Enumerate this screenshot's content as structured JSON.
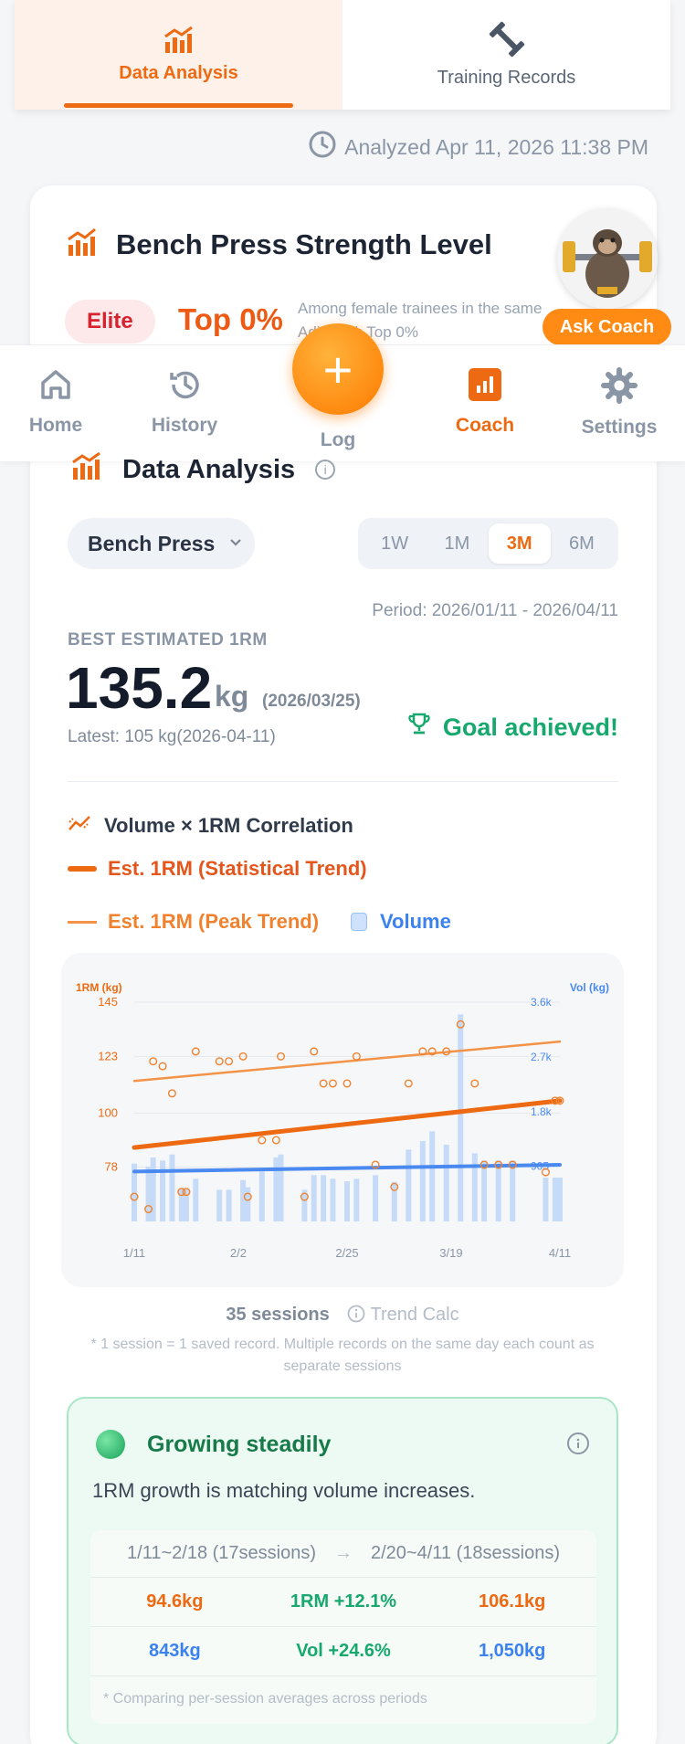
{
  "top_tabs": [
    {
      "label": "Data Analysis",
      "active": true,
      "icon": "bar-chart-up-icon"
    },
    {
      "label": "Training Records",
      "active": false,
      "icon": "dumbbell-icon"
    }
  ],
  "analyzed": "Analyzed Apr 11, 2026 11:38 PM",
  "strength": {
    "title": "Bench Press Strength Level",
    "badge": "Elite",
    "top": "Top 0%",
    "among_line1": "Among female trainees in the same",
    "among_line2": "Adjusted: Top 0%",
    "ask_coach": "Ask Coach"
  },
  "nav": {
    "items": [
      {
        "label": "Home",
        "icon": "home-icon"
      },
      {
        "label": "History",
        "icon": "history-icon"
      },
      {
        "label": "Coach",
        "icon": "coach-icon",
        "active": true
      },
      {
        "label": "Settings",
        "icon": "gear-icon"
      }
    ],
    "fab_label": "Log",
    "fab_symbol": "+"
  },
  "analysis": {
    "title": "Data Analysis",
    "info": "i",
    "exercise": "Bench Press",
    "ranges": [
      "1W",
      "1M",
      "3M",
      "6M"
    ],
    "active_range": "3M",
    "period": "Period: 2026/01/11 - 2026/04/11",
    "best_label": "BEST ESTIMATED 1RM",
    "best_value": "135.2",
    "best_unit": "kg",
    "best_date": "(2026/03/25)",
    "latest": "Latest: 105 kg(2026-04-11)",
    "goal": "Goal achieved!"
  },
  "correlation": {
    "title": "Volume × 1RM Correlation",
    "legend_stat": "Est. 1RM (Statistical Trend)",
    "legend_peak": "Est. 1RM (Peak Trend)",
    "legend_volume": "Volume"
  },
  "colors": {
    "accent": "#ee6a12",
    "peak": "#f39348",
    "volume_bar": "#c6dbf7",
    "volume_trend": "#4a8af0",
    "success": "#17a86d"
  },
  "chart_data": {
    "type": "line",
    "left_axis_label": "1RM (kg)",
    "right_axis_label": "Vol (kg)",
    "left_ticks": [
      78,
      100,
      123,
      145
    ],
    "right_ticks": [
      "905",
      "1.8k",
      "2.7k",
      "3.6k"
    ],
    "ylim_left": [
      56,
      145
    ],
    "ylim_right": [
      0,
      3600
    ],
    "x_ticks": [
      "1/11",
      "2/2",
      "2/25",
      "3/19",
      "4/11"
    ],
    "x_tick_days": [
      0,
      22,
      45,
      67,
      90
    ],
    "sessions": [
      {
        "day": 0,
        "orm": 66,
        "vol": 950
      },
      {
        "day": 3,
        "orm": 61,
        "vol": 900
      },
      {
        "day": 4,
        "orm": 121,
        "vol": 1050
      },
      {
        "day": 6,
        "orm": 119,
        "vol": 1000
      },
      {
        "day": 8,
        "orm": 108,
        "vol": 1100
      },
      {
        "day": 10,
        "orm": 68,
        "vol": 540
      },
      {
        "day": 11,
        "orm": 68,
        "vol": 540
      },
      {
        "day": 13,
        "orm": 125,
        "vol": 700
      },
      {
        "day": 18,
        "orm": 121,
        "vol": 520
      },
      {
        "day": 20,
        "orm": 121,
        "vol": 520
      },
      {
        "day": 23,
        "orm": 123,
        "vol": 680
      },
      {
        "day": 24,
        "orm": 66,
        "vol": 560
      },
      {
        "day": 27,
        "orm": 89,
        "vol": 820
      },
      {
        "day": 30,
        "orm": 89,
        "vol": 1050
      },
      {
        "day": 31,
        "orm": 123,
        "vol": 1100
      },
      {
        "day": 36,
        "orm": 66,
        "vol": 520
      },
      {
        "day": 38,
        "orm": 125,
        "vol": 760
      },
      {
        "day": 40,
        "orm": 112,
        "vol": 760
      },
      {
        "day": 42,
        "orm": 112,
        "vol": 700
      },
      {
        "day": 45,
        "orm": 112,
        "vol": 660
      },
      {
        "day": 47,
        "orm": 123,
        "vol": 700
      },
      {
        "day": 51,
        "orm": 79,
        "vol": 760
      },
      {
        "day": 55,
        "orm": 70,
        "vol": 650
      },
      {
        "day": 58,
        "orm": 112,
        "vol": 1180
      },
      {
        "day": 61,
        "orm": 125,
        "vol": 1320
      },
      {
        "day": 63,
        "orm": 125,
        "vol": 1480
      },
      {
        "day": 66,
        "orm": 125,
        "vol": 1260
      },
      {
        "day": 69,
        "orm": 136,
        "vol": 3400
      },
      {
        "day": 72,
        "orm": 112,
        "vol": 1120
      },
      {
        "day": 74,
        "orm": 79,
        "vol": 1000
      },
      {
        "day": 77,
        "orm": 79,
        "vol": 1000
      },
      {
        "day": 80,
        "orm": 79,
        "vol": 1000
      },
      {
        "day": 87,
        "orm": 76,
        "vol": 720
      },
      {
        "day": 89,
        "orm": 105,
        "vol": 720
      },
      {
        "day": 90,
        "orm": 105,
        "vol": 720
      }
    ],
    "stat_trend": {
      "start": 86,
      "end": 105
    },
    "peak_trend": {
      "start": 113,
      "end": 129
    },
    "volume_trend": {
      "start": 820,
      "end": 930
    }
  },
  "sessions_info": {
    "count": "35 sessions",
    "trend_calc": "Trend Calc",
    "footnote": "* 1 session = 1 saved record. Multiple records on the same day each count as separate sessions"
  },
  "growth": {
    "title": "Growing steadily",
    "desc": "1RM growth is matching volume increases.",
    "period_a": "1/11~2/18 (17sessions)",
    "arrow": "→",
    "period_b": "2/20~4/11 (18sessions)",
    "orm_a": "94.6kg",
    "orm_change": "1RM +12.1%",
    "orm_b": "106.1kg",
    "vol_a": "843kg",
    "vol_change": "Vol +24.6%",
    "vol_b": "1,050kg",
    "note": "* Comparing per-session averages across periods"
  }
}
